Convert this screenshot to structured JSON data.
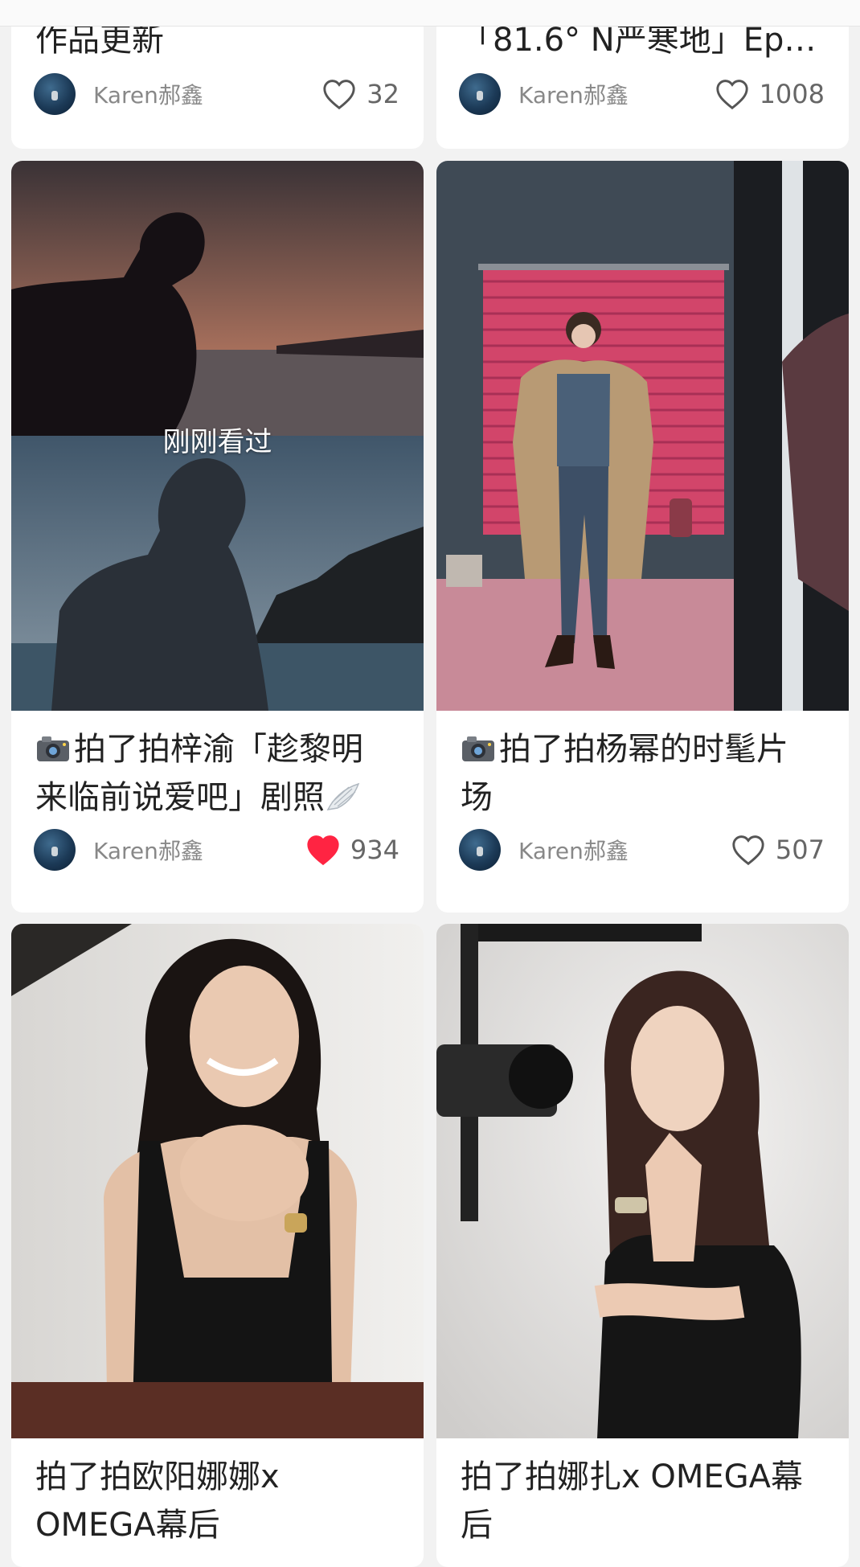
{
  "accent_like": "#ff2442",
  "cards": [
    {
      "title": "作品更新",
      "author": "Karen郝鑫",
      "likes": "32",
      "liked": false
    },
    {
      "title": "「81.6° N严寒地」Ep…",
      "author": "Karen郝鑫",
      "likes": "1008",
      "liked": false
    },
    {
      "title_line1": "拍了拍梓渝「趁黎明",
      "title_line2": "来临前说爱吧」剧照",
      "author": "Karen郝鑫",
      "likes": "934",
      "liked": true,
      "badge": "刚刚看过"
    },
    {
      "title_line1": "拍了拍杨幂的时髦片",
      "title_line2": "场",
      "author": "Karen郝鑫",
      "likes": "507",
      "liked": false
    },
    {
      "title_line1": "拍了拍欧阳娜娜x",
      "title_line2": "OMEGA幕后"
    },
    {
      "title_line1": "拍了拍娜扎x OMEGA幕",
      "title_line2": "后"
    }
  ]
}
